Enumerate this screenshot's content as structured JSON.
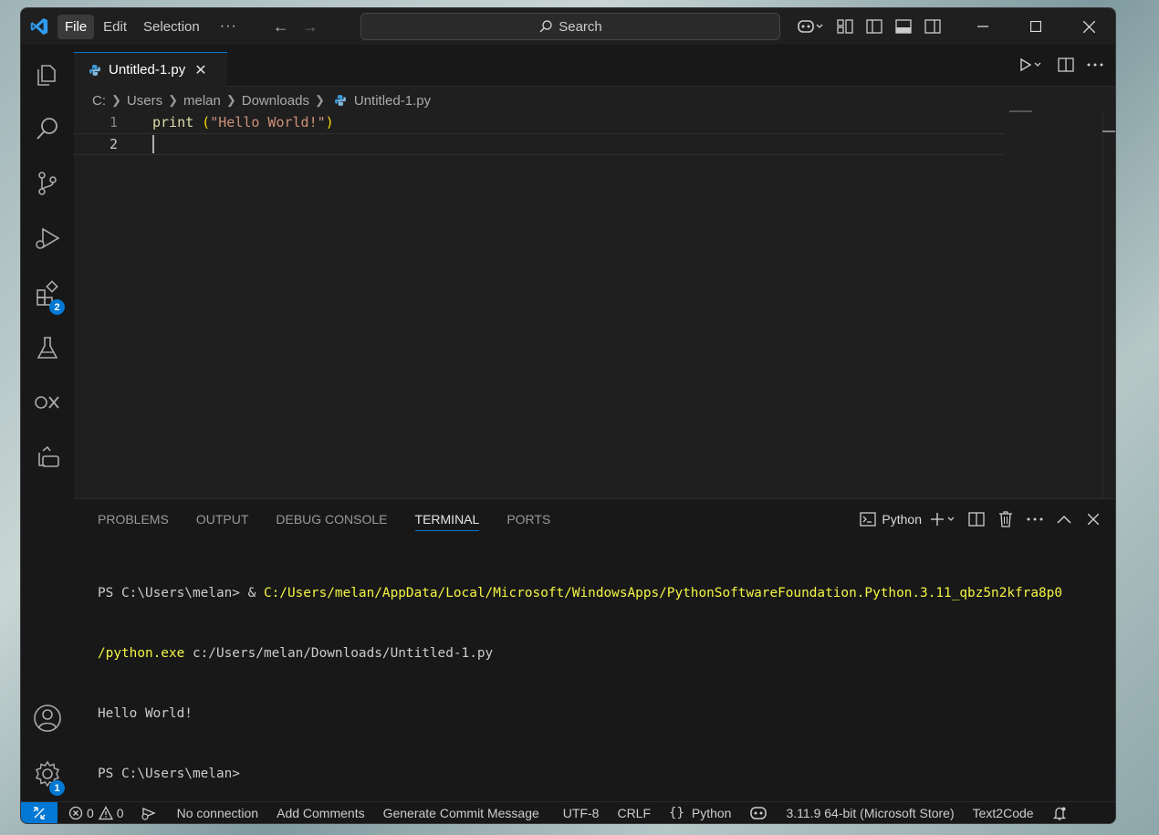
{
  "menu": {
    "file": "File",
    "edit": "Edit",
    "selection": "Selection",
    "more": "···"
  },
  "search": {
    "label": "Search"
  },
  "tab": {
    "filename": "Untitled-1.py",
    "close": "✕"
  },
  "breadcrumb": [
    "C:",
    "Users",
    "melan",
    "Downloads",
    "Untitled-1.py"
  ],
  "editor": {
    "lines": [
      {
        "number": "1",
        "func": "print",
        "open": " (",
        "string": "\"Hello World!\"",
        "close": ")"
      },
      {
        "number": "2"
      }
    ]
  },
  "activity_badges": {
    "extensions": "2",
    "settings": "1"
  },
  "panel": {
    "tabs": [
      "PROBLEMS",
      "OUTPUT",
      "DEBUG CONSOLE",
      "TERMINAL",
      "PORTS"
    ],
    "active_tab": "TERMINAL",
    "terminal_profile": "Python"
  },
  "terminal": {
    "line1_prompt": "PS C:\\Users\\melan> & ",
    "line1_path": "C:/Users/melan/AppData/Local/Microsoft/WindowsApps/PythonSoftwareFoundation.Python.3.11_qbz5n2kfra8p0",
    "line2_path": "/python.exe",
    "line2_arg": " c:/Users/melan/Downloads/Untitled-1.py",
    "line3": "Hello World!",
    "line4": "PS C:\\Users\\melan>"
  },
  "status": {
    "errors": "0",
    "warnings": "0",
    "connection": "No connection",
    "add_comments": "Add Comments",
    "commit_msg": "Generate Commit Message",
    "encoding": "UTF-8",
    "eol": "CRLF",
    "language": "Python",
    "interpreter": "3.11.9 64-bit (Microsoft Store)",
    "text2code": "Text2Code"
  },
  "colors": {
    "accent": "#0078d4",
    "string": "#ce9178",
    "function": "#dcdcaa",
    "bracket": "#ffd700",
    "terminal_path": "#f5f543"
  }
}
